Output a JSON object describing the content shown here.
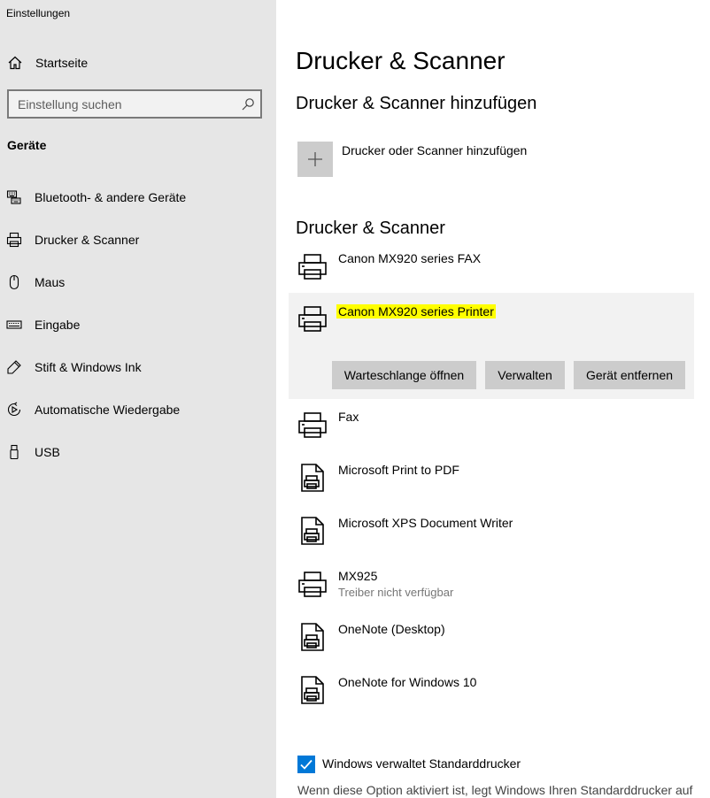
{
  "app_title": "Einstellungen",
  "sidebar": {
    "home_label": "Startseite",
    "search_placeholder": "Einstellung suchen",
    "section_title": "Geräte",
    "items": [
      {
        "label": "Bluetooth- & andere Geräte",
        "icon": "keyboard-bluetooth-icon"
      },
      {
        "label": "Drucker & Scanner",
        "icon": "printer-icon"
      },
      {
        "label": "Maus",
        "icon": "mouse-icon"
      },
      {
        "label": "Eingabe",
        "icon": "keyboard-icon"
      },
      {
        "label": "Stift & Windows Ink",
        "icon": "pen-icon"
      },
      {
        "label": "Automatische Wiedergabe",
        "icon": "autoplay-icon"
      },
      {
        "label": "USB",
        "icon": "usb-icon"
      }
    ]
  },
  "main": {
    "title": "Drucker & Scanner",
    "add_section_title": "Drucker & Scanner hinzufügen",
    "add_label": "Drucker oder Scanner hinzufügen",
    "list_section_title": "Drucker & Scanner",
    "devices": [
      {
        "name": "Canon MX920 series FAX",
        "status": "",
        "icon": "printer-icon"
      },
      {
        "name": "Canon MX920 series Printer",
        "status": "",
        "icon": "printer-icon",
        "selected": true
      },
      {
        "name": "Fax",
        "status": "",
        "icon": "printer-icon"
      },
      {
        "name": "Microsoft Print to PDF",
        "status": "",
        "icon": "document-printer-icon"
      },
      {
        "name": "Microsoft XPS Document Writer",
        "status": "",
        "icon": "document-printer-icon"
      },
      {
        "name": "MX925",
        "status": "Treiber nicht verfügbar",
        "icon": "printer-icon"
      },
      {
        "name": "OneNote (Desktop)",
        "status": "",
        "icon": "document-printer-icon"
      },
      {
        "name": "OneNote for Windows 10",
        "status": "",
        "icon": "document-printer-icon"
      }
    ],
    "actions": {
      "queue": "Warteschlange öffnen",
      "manage": "Verwalten",
      "remove": "Gerät entfernen"
    },
    "default_printer_checkbox": {
      "label": "Windows verwaltet Standarddrucker",
      "checked": true
    },
    "default_printer_desc": "Wenn diese Option aktiviert ist, legt Windows Ihren Standarddrucker auf"
  },
  "colors": {
    "sidebar_bg": "#e6e6e6",
    "accent": "#0078d7",
    "highlight": "#ffff00",
    "button_bg": "#cccccc",
    "selected_bg": "#f2f2f2"
  }
}
